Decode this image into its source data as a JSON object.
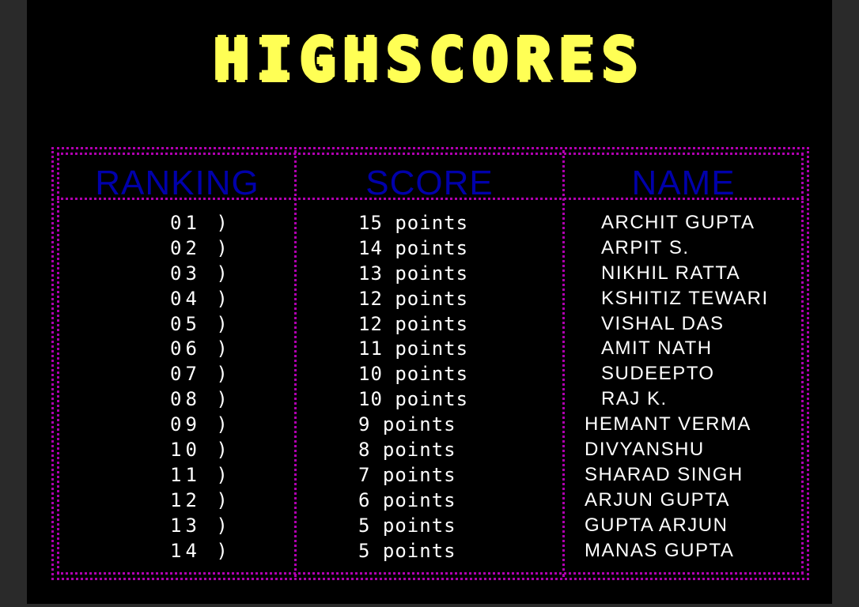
{
  "title": "HIGHSCORES",
  "headers": {
    "rank": "RANKING",
    "score": "SCORE",
    "name": "NAME"
  },
  "colors": {
    "title": "#ffff55",
    "border": "#b000b0",
    "header": "#0000aa",
    "text": "#ffffff",
    "background": "#000000"
  },
  "rows": [
    {
      "rank": "01 )",
      "score": "15 points",
      "name": "ARCHIT GUPTA"
    },
    {
      "rank": "02 )",
      "score": "14 points",
      "name": "ARPIT S."
    },
    {
      "rank": "03 )",
      "score": "13 points",
      "name": "NIKHIL RATTA"
    },
    {
      "rank": "04 )",
      "score": "12 points",
      "name": "KSHITIZ TEWARI"
    },
    {
      "rank": "05 )",
      "score": "12 points",
      "name": "VISHAL DAS"
    },
    {
      "rank": "06 )",
      "score": "11 points",
      "name": "AMIT NATH"
    },
    {
      "rank": "07 )",
      "score": "10 points",
      "name": "SUDEEPTO"
    },
    {
      "rank": "08 )",
      "score": "10 points",
      "name": "RAJ K."
    },
    {
      "rank": "09 )",
      "score": "9 points",
      "name": "HEMANT VERMA"
    },
    {
      "rank": "10 )",
      "score": "8 points",
      "name": "DIVYANSHU"
    },
    {
      "rank": "11 )",
      "score": "7 points",
      "name": "SHARAD SINGH"
    },
    {
      "rank": "12 )",
      "score": "6 points",
      "name": "ARJUN GUPTA"
    },
    {
      "rank": "13 )",
      "score": "5 points",
      "name": "GUPTA ARJUN"
    },
    {
      "rank": "14 )",
      "score": "5 points",
      "name": "MANAS GUPTA"
    }
  ]
}
